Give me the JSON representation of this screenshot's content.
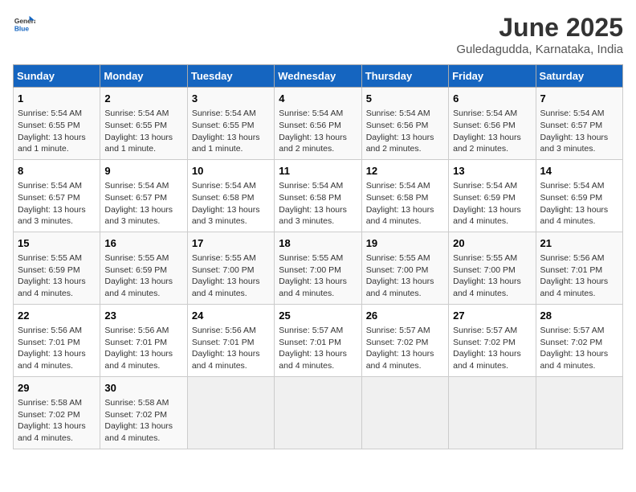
{
  "header": {
    "logo_general": "General",
    "logo_blue": "Blue",
    "title": "June 2025",
    "subtitle": "Guledagudda, Karnataka, India"
  },
  "columns": [
    "Sunday",
    "Monday",
    "Tuesday",
    "Wednesday",
    "Thursday",
    "Friday",
    "Saturday"
  ],
  "weeks": [
    [
      {
        "day": "1",
        "info": "Sunrise: 5:54 AM\nSunset: 6:55 PM\nDaylight: 13 hours and 1 minute."
      },
      {
        "day": "2",
        "info": "Sunrise: 5:54 AM\nSunset: 6:55 PM\nDaylight: 13 hours and 1 minute."
      },
      {
        "day": "3",
        "info": "Sunrise: 5:54 AM\nSunset: 6:55 PM\nDaylight: 13 hours and 1 minute."
      },
      {
        "day": "4",
        "info": "Sunrise: 5:54 AM\nSunset: 6:56 PM\nDaylight: 13 hours and 2 minutes."
      },
      {
        "day": "5",
        "info": "Sunrise: 5:54 AM\nSunset: 6:56 PM\nDaylight: 13 hours and 2 minutes."
      },
      {
        "day": "6",
        "info": "Sunrise: 5:54 AM\nSunset: 6:56 PM\nDaylight: 13 hours and 2 minutes."
      },
      {
        "day": "7",
        "info": "Sunrise: 5:54 AM\nSunset: 6:57 PM\nDaylight: 13 hours and 3 minutes."
      }
    ],
    [
      {
        "day": "8",
        "info": "Sunrise: 5:54 AM\nSunset: 6:57 PM\nDaylight: 13 hours and 3 minutes."
      },
      {
        "day": "9",
        "info": "Sunrise: 5:54 AM\nSunset: 6:57 PM\nDaylight: 13 hours and 3 minutes."
      },
      {
        "day": "10",
        "info": "Sunrise: 5:54 AM\nSunset: 6:58 PM\nDaylight: 13 hours and 3 minutes."
      },
      {
        "day": "11",
        "info": "Sunrise: 5:54 AM\nSunset: 6:58 PM\nDaylight: 13 hours and 3 minutes."
      },
      {
        "day": "12",
        "info": "Sunrise: 5:54 AM\nSunset: 6:58 PM\nDaylight: 13 hours and 4 minutes."
      },
      {
        "day": "13",
        "info": "Sunrise: 5:54 AM\nSunset: 6:59 PM\nDaylight: 13 hours and 4 minutes."
      },
      {
        "day": "14",
        "info": "Sunrise: 5:54 AM\nSunset: 6:59 PM\nDaylight: 13 hours and 4 minutes."
      }
    ],
    [
      {
        "day": "15",
        "info": "Sunrise: 5:55 AM\nSunset: 6:59 PM\nDaylight: 13 hours and 4 minutes."
      },
      {
        "day": "16",
        "info": "Sunrise: 5:55 AM\nSunset: 6:59 PM\nDaylight: 13 hours and 4 minutes."
      },
      {
        "day": "17",
        "info": "Sunrise: 5:55 AM\nSunset: 7:00 PM\nDaylight: 13 hours and 4 minutes."
      },
      {
        "day": "18",
        "info": "Sunrise: 5:55 AM\nSunset: 7:00 PM\nDaylight: 13 hours and 4 minutes."
      },
      {
        "day": "19",
        "info": "Sunrise: 5:55 AM\nSunset: 7:00 PM\nDaylight: 13 hours and 4 minutes."
      },
      {
        "day": "20",
        "info": "Sunrise: 5:55 AM\nSunset: 7:00 PM\nDaylight: 13 hours and 4 minutes."
      },
      {
        "day": "21",
        "info": "Sunrise: 5:56 AM\nSunset: 7:01 PM\nDaylight: 13 hours and 4 minutes."
      }
    ],
    [
      {
        "day": "22",
        "info": "Sunrise: 5:56 AM\nSunset: 7:01 PM\nDaylight: 13 hours and 4 minutes."
      },
      {
        "day": "23",
        "info": "Sunrise: 5:56 AM\nSunset: 7:01 PM\nDaylight: 13 hours and 4 minutes."
      },
      {
        "day": "24",
        "info": "Sunrise: 5:56 AM\nSunset: 7:01 PM\nDaylight: 13 hours and 4 minutes."
      },
      {
        "day": "25",
        "info": "Sunrise: 5:57 AM\nSunset: 7:01 PM\nDaylight: 13 hours and 4 minutes."
      },
      {
        "day": "26",
        "info": "Sunrise: 5:57 AM\nSunset: 7:02 PM\nDaylight: 13 hours and 4 minutes."
      },
      {
        "day": "27",
        "info": "Sunrise: 5:57 AM\nSunset: 7:02 PM\nDaylight: 13 hours and 4 minutes."
      },
      {
        "day": "28",
        "info": "Sunrise: 5:57 AM\nSunset: 7:02 PM\nDaylight: 13 hours and 4 minutes."
      }
    ],
    [
      {
        "day": "29",
        "info": "Sunrise: 5:58 AM\nSunset: 7:02 PM\nDaylight: 13 hours and 4 minutes."
      },
      {
        "day": "30",
        "info": "Sunrise: 5:58 AM\nSunset: 7:02 PM\nDaylight: 13 hours and 4 minutes."
      },
      {
        "day": "",
        "info": ""
      },
      {
        "day": "",
        "info": ""
      },
      {
        "day": "",
        "info": ""
      },
      {
        "day": "",
        "info": ""
      },
      {
        "day": "",
        "info": ""
      }
    ]
  ]
}
